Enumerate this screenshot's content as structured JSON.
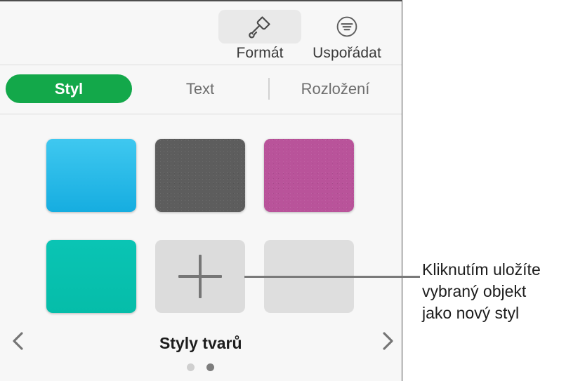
{
  "panel": {
    "toolbar": {
      "buttons": [
        {
          "label": "Formát",
          "icon": "paintbrush-icon",
          "active": true
        },
        {
          "label": "Uspořádat",
          "icon": "arrange-align-icon",
          "active": false
        }
      ]
    },
    "tabs": [
      {
        "label": "Styl",
        "active": true
      },
      {
        "label": "Text",
        "active": false
      },
      {
        "label": "Rozložení",
        "active": false
      }
    ],
    "navigation": {
      "prev_icon": "chevron-left-icon",
      "next_icon": "chevron-right-icon"
    },
    "styles": {
      "section_label": "Styly tvarů",
      "swatches": [
        {
          "name": "style-swatch-cyan",
          "kind": "color",
          "color": "#3FC8F0",
          "color_bottom": "#16ADE0"
        },
        {
          "name": "style-swatch-gray-textured",
          "kind": "texture",
          "color": "#5d5d5d"
        },
        {
          "name": "style-swatch-pink",
          "kind": "texture",
          "color": "#b9539a"
        },
        {
          "name": "style-swatch-teal",
          "kind": "color",
          "color": "#0ac4b4",
          "color_bottom": "#05bda9"
        },
        {
          "name": "add-style-button",
          "kind": "add",
          "color": "#dcdcdc",
          "icon": "plus-icon"
        },
        {
          "name": "style-swatch-empty",
          "kind": "empty",
          "color": "#dedede"
        }
      ],
      "page_dots": [
        {
          "active": false
        },
        {
          "active": true
        }
      ]
    }
  },
  "callout": {
    "lines": [
      "Kliknutím uložíte",
      "vybraný objekt",
      "jako nový styl"
    ]
  },
  "colors": {
    "accent_green": "#13a84a",
    "panel_bg": "#f7f7f7",
    "text_primary": "#1d1d1d",
    "text_secondary": "#6e6e6e"
  }
}
